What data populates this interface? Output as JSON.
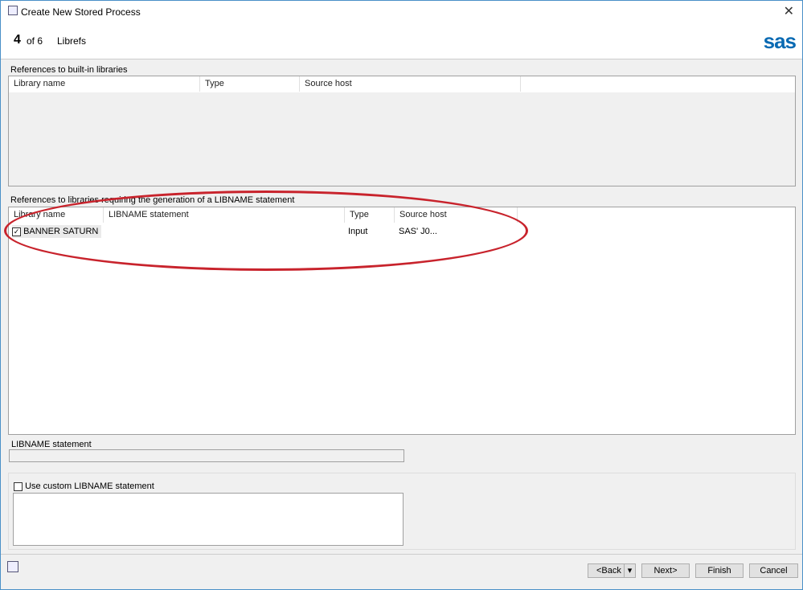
{
  "window": {
    "title": "Create New Stored Process",
    "close": "✕"
  },
  "header": {
    "step": "4",
    "of": "of 6",
    "title": "Librefs",
    "logo": "sas"
  },
  "builtin": {
    "label": "References to built-in libraries",
    "columns": [
      "Library name",
      "Type",
      "Source host"
    ]
  },
  "libname_refs": {
    "label": "References to libraries requiring the generation of a LIBNAME statement",
    "columns": [
      "Library name",
      "LIBNAME statement",
      "Type",
      "Source host"
    ],
    "rows": [
      {
        "checked": true,
        "library": "BANNER SATURN",
        "statement": "",
        "type": "Input",
        "host": "SAS' J0..."
      }
    ]
  },
  "statement": {
    "label": "LIBNAME statement",
    "value": ""
  },
  "custom": {
    "label": "Use custom LIBNAME statement",
    "checked": false,
    "value": ""
  },
  "buttons": {
    "back": "<Back",
    "next": "Next>",
    "finish": "Finish",
    "cancel": "Cancel"
  },
  "annotation_color": "#c8232c"
}
